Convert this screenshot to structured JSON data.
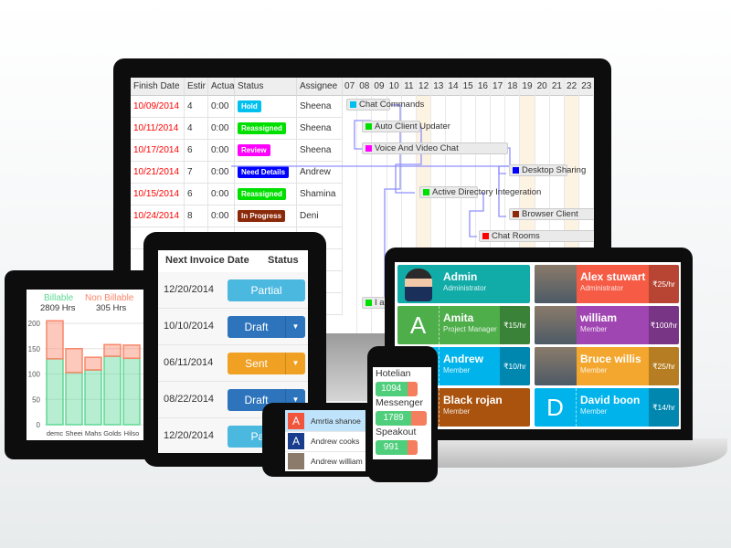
{
  "gantt": {
    "headers": [
      "Finish Date",
      "Estir",
      "Actua",
      "Status",
      "Assignee"
    ],
    "days": [
      "07",
      "08",
      "09",
      "10",
      "11",
      "12",
      "13",
      "14",
      "15",
      "16",
      "17",
      "18",
      "19",
      "20",
      "21",
      "22",
      "23"
    ],
    "rows": [
      {
        "finish": "10/09/2014",
        "est": "4",
        "actual": "0:00",
        "status": "Hold",
        "status_color": "#00c0f0",
        "assignee": "Sheena"
      },
      {
        "finish": "10/11/2014",
        "est": "4",
        "actual": "0:00",
        "status": "Reassigned",
        "status_color": "#00e000",
        "assignee": "Sheena"
      },
      {
        "finish": "10/17/2014",
        "est": "6",
        "actual": "0:00",
        "status": "Review",
        "status_color": "#ff00ff",
        "assignee": "Sheena"
      },
      {
        "finish": "10/21/2014",
        "est": "7",
        "actual": "0:00",
        "status": "Need Details",
        "status_color": "#0000ff",
        "assignee": "Andrew"
      },
      {
        "finish": "10/15/2014",
        "est": "6",
        "actual": "0:00",
        "status": "Reassigned",
        "status_color": "#00e000",
        "assignee": "Shamina"
      },
      {
        "finish": "10/24/2014",
        "est": "8",
        "actual": "0:00",
        "status": "In Progress",
        "status_color": "#8b2a0a",
        "assignee": "Deni"
      }
    ],
    "tasks": [
      {
        "name": "Chat Commands",
        "color": "#00c0f0"
      },
      {
        "name": "Auto Client Updater",
        "color": "#00e000"
      },
      {
        "name": "Voice And Video Chat",
        "color": "#ff00ff"
      },
      {
        "name": "Desktop Sharing",
        "color": "#0000ff"
      },
      {
        "name": "Active Directory Integeration",
        "color": "#00e000"
      },
      {
        "name": "Browser Client",
        "color": "#8b2a0a"
      },
      {
        "name": "Chat Rooms",
        "color": "#ff0000"
      },
      {
        "name": "I am",
        "color": "#00e000"
      }
    ]
  },
  "invoice": {
    "headers": [
      "Next Invoice Date",
      "Status"
    ],
    "rows": [
      {
        "date": "12/20/2014",
        "status": "Partial",
        "color": "#4bb8e0",
        "dropdown": false
      },
      {
        "date": "10/10/2014",
        "status": "Draft",
        "color": "#2e74bd",
        "dropdown": true
      },
      {
        "date": "06/11/2014",
        "status": "Sent",
        "color": "#f0a023",
        "dropdown": true
      },
      {
        "date": "08/22/2014",
        "status": "Draft",
        "color": "#2e74bd",
        "dropdown": true
      },
      {
        "date": "12/20/2014",
        "status": "Partial",
        "color": "#4bb8e0",
        "dropdown": false
      }
    ]
  },
  "chart_data": {
    "type": "bar",
    "stacked": true,
    "categories": [
      "demc",
      "Sheei",
      "Mahs",
      "Golds",
      "Hilso"
    ],
    "series": [
      {
        "name": "Billable",
        "total": "2809 Hrs",
        "color": "#5fd896",
        "values": [
          130,
          103,
          108,
          135,
          131
        ]
      },
      {
        "name": "Non Billable",
        "total": "305 Hrs",
        "color": "#f9876a",
        "values": [
          75,
          47,
          25,
          23,
          26
        ]
      }
    ],
    "yticks": [
      "200",
      "150",
      "100",
      "50",
      "0"
    ],
    "ylim": [
      0,
      210
    ],
    "grid": true
  },
  "team": [
    {
      "name": "Admin",
      "role": "Administrator",
      "rate": "",
      "color": "#12aca8",
      "avatar": "admin-avatar"
    },
    {
      "name": "Alex stuwart",
      "role": "Administrator",
      "rate": "₹25/hr",
      "color": "#f65b45",
      "avatar": "photo"
    },
    {
      "name": "Amita",
      "role": "Project Manager",
      "rate": "₹15/hr",
      "color": "#4eae4a",
      "letter": "A"
    },
    {
      "name": "william",
      "role": "Member",
      "rate": "₹100/hr",
      "color": "#a046b2",
      "avatar": "photo"
    },
    {
      "name": "Andrew",
      "role": "Member",
      "rate": "₹10/hr",
      "color": "#00b4eb",
      "letter": ""
    },
    {
      "name": "Bruce willis",
      "role": "Member",
      "rate": "₹25/hr",
      "color": "#f3a72e",
      "avatar": "photo"
    },
    {
      "name": "Black rojan",
      "role": "Member",
      "rate": "",
      "color": "#a9530f",
      "letter": ""
    },
    {
      "name": "David boon",
      "role": "Member",
      "rate": "₹14/hr",
      "color": "#00b4eb",
      "letter": "D"
    }
  ],
  "contacts": [
    {
      "name": "Amrtia shanoe",
      "letter": "A",
      "color": "#f2553e",
      "selected": true
    },
    {
      "name": "Andrew cooks",
      "letter": "A",
      "color": "#173d8c",
      "selected": false
    },
    {
      "name": "Andrew william",
      "letter": "",
      "color": "#8a7b6a",
      "selected": false
    }
  ],
  "apps": [
    {
      "name": "Hotelian",
      "value": "1094",
      "fill": 0.75
    },
    {
      "name": "Messenger",
      "value": "1789",
      "fill": 0.7
    },
    {
      "name": "Speakout",
      "value": "991",
      "fill": 0.75
    }
  ]
}
